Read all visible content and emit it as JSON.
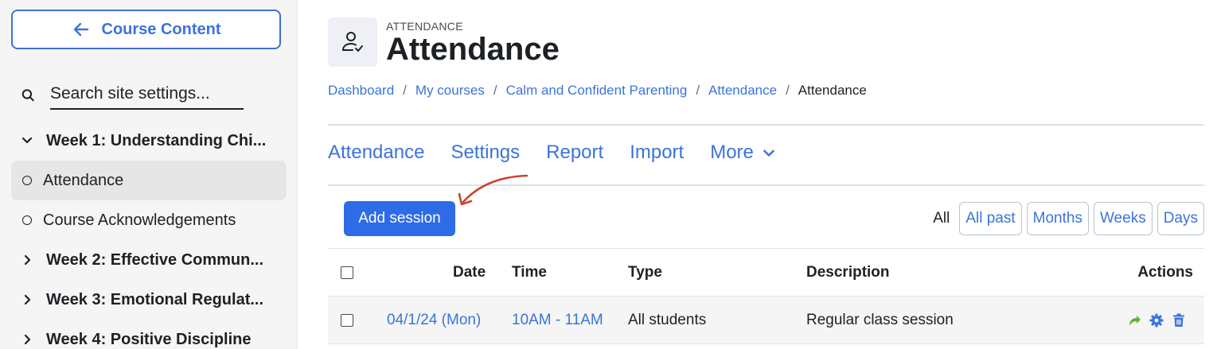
{
  "sidebar": {
    "back_label": "Course Content",
    "search_placeholder": "Search site settings...",
    "items": [
      {
        "label": "Week 1: Understanding Chi..."
      },
      {
        "label": "Attendance"
      },
      {
        "label": "Course Acknowledgements"
      },
      {
        "label": "Week 2: Effective Commun..."
      },
      {
        "label": "Week 3: Emotional Regulat..."
      },
      {
        "label": "Week 4: Positive Discipline"
      }
    ]
  },
  "header": {
    "label": "ATTENDANCE",
    "title": "Attendance"
  },
  "breadcrumb": [
    "Dashboard",
    "My courses",
    "Calm and Confident Parenting",
    "Attendance",
    "Attendance"
  ],
  "tabs": [
    "Attendance",
    "Settings",
    "Report",
    "Import",
    "More"
  ],
  "add_session_label": "Add session",
  "filters": {
    "all": "All",
    "buttons": [
      "All past",
      "Months",
      "Weeks",
      "Days"
    ]
  },
  "table": {
    "headers": {
      "date": "Date",
      "time": "Time",
      "type": "Type",
      "description": "Description",
      "actions": "Actions"
    },
    "rows": [
      {
        "date": "04/1/24 (Mon)",
        "time": "10AM - 11AM",
        "type": "All students",
        "description": "Regular class session"
      }
    ]
  },
  "colors": {
    "accent": "#3b73db",
    "primary_button": "#2e6be6",
    "annotation_arrow": "#c9452f",
    "take_attendance_icon": "#5bb32e"
  }
}
